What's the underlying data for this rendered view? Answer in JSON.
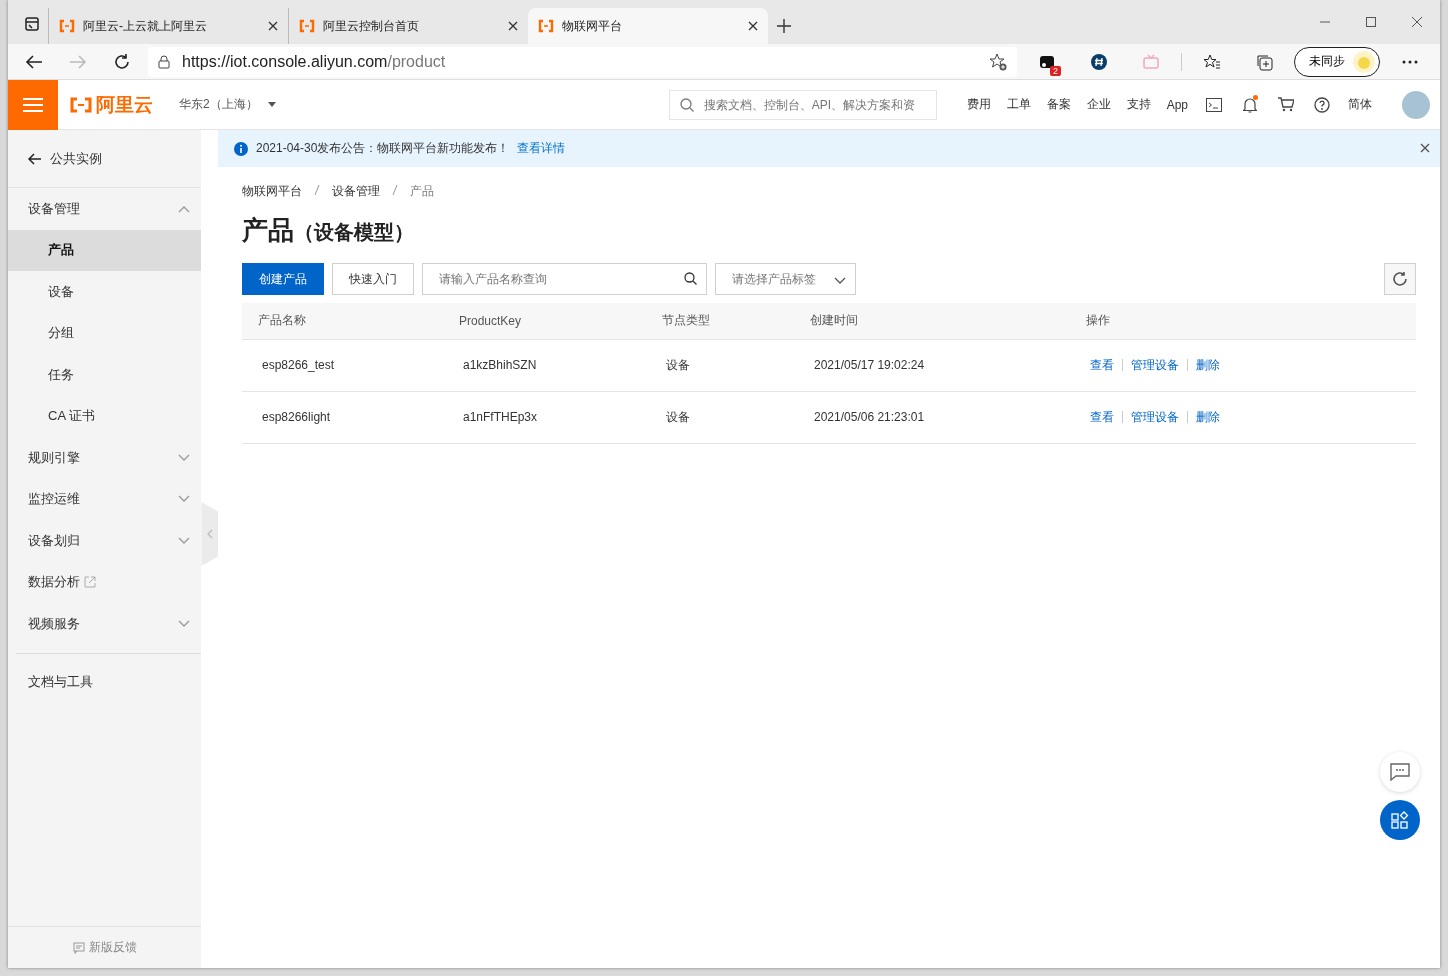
{
  "browser": {
    "tabs": [
      {
        "title": "阿里云-上云就上阿里云",
        "selected": false
      },
      {
        "title": "阿里云控制台首页",
        "selected": false
      },
      {
        "title": "物联网平台",
        "selected": true
      }
    ],
    "url": {
      "host": "https://iot.console.aliyun.com",
      "path": "/product"
    },
    "extension_badge": "2",
    "sync_button": "未同步"
  },
  "topbar": {
    "brand": "阿里云",
    "region": "华东2（上海）",
    "search": {
      "placeholder": "搜索文档、控制台、API、解决方案和资"
    },
    "links": [
      "费用",
      "工单",
      "备案",
      "企业",
      "支持",
      "App"
    ],
    "notifications_unread": true,
    "language": "简体"
  },
  "sidebar": {
    "back": "公共实例",
    "items": [
      {
        "kind": "group",
        "label": "设备管理",
        "expanded": true,
        "children": [
          {
            "label": "产品",
            "selected": true
          },
          {
            "label": "设备",
            "selected": false
          },
          {
            "label": "分组",
            "selected": false
          },
          {
            "label": "任务",
            "selected": false
          },
          {
            "label": "CA 证书",
            "selected": false
          }
        ]
      },
      {
        "kind": "group",
        "label": "规则引擎",
        "expanded": false
      },
      {
        "kind": "group",
        "label": "监控运维",
        "expanded": false
      },
      {
        "kind": "group",
        "label": "设备划归",
        "expanded": false
      },
      {
        "kind": "external",
        "label": "数据分析"
      },
      {
        "kind": "group",
        "label": "视频服务",
        "expanded": false
      },
      {
        "kind": "divider"
      },
      {
        "kind": "link",
        "label": "文档与工具"
      }
    ],
    "feedback": "新版反馈"
  },
  "notice": {
    "text": "2021-04-30发布公告：物联网平台新功能发布！",
    "link": "查看详情"
  },
  "breadcrumb": [
    "物联网平台",
    "设备管理",
    "产品"
  ],
  "page_title": {
    "main": "产品",
    "sub": "（设备模型）"
  },
  "toolbar": {
    "create_button": "创建产品",
    "quickstart_button": "快速入门",
    "search": {
      "placeholder": "请输入产品名称查询"
    },
    "tag_select": {
      "placeholder": "请选择产品标签"
    }
  },
  "table": {
    "columns": [
      "产品名称",
      "ProductKey",
      "节点类型",
      "创建时间",
      "操作"
    ],
    "rows": [
      {
        "cells": [
          "esp8266_test",
          "a1kzBhihSZN",
          "设备",
          "2021/05/17 19:02:24"
        ],
        "actions": [
          "查看",
          "管理设备",
          "删除"
        ]
      },
      {
        "cells": [
          "esp8266light",
          "a1nFfTHEp3x",
          "设备",
          "2021/05/06 21:23:01"
        ],
        "actions": [
          "查看",
          "管理设备",
          "删除"
        ]
      }
    ]
  }
}
